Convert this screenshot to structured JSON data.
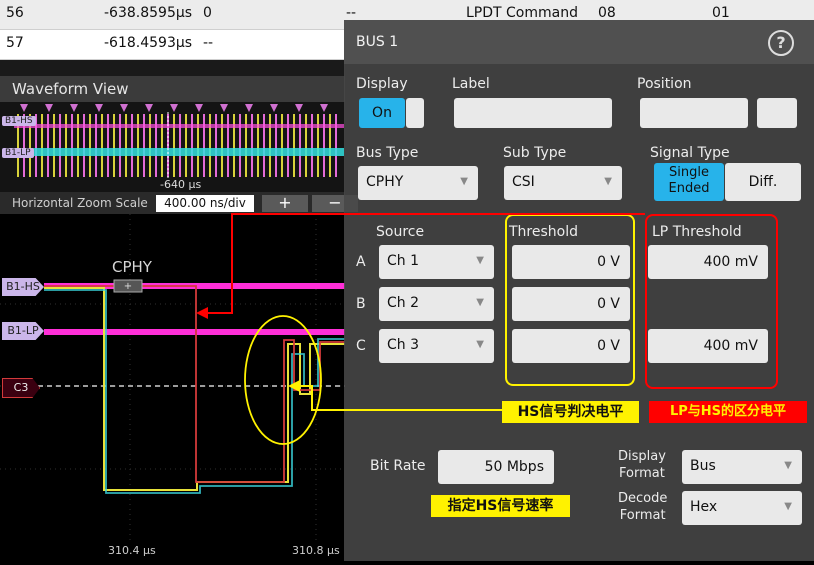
{
  "results": {
    "rows": [
      {
        "index": "56",
        "time": "-638.8595µs",
        "v1": "0",
        "v2": "--",
        "cmd": "LPDT Command",
        "c6": "08",
        "c7": "01"
      },
      {
        "index": "57",
        "time": "-618.4593µs",
        "v1": "--"
      }
    ]
  },
  "waveform_view": {
    "title": "Waveform View",
    "time_mark": "-640 µs",
    "zoom_label": "Horizontal Zoom Scale",
    "zoom_value": "400.00 ns/div",
    "zoom_in": "+",
    "zoom_out": "−",
    "bus_label": "CPHY",
    "lane_hs": "B1-HS",
    "lane_lp": "B1-LP",
    "channel": "C3",
    "time_left": "310.4 µs",
    "time_right": "310.8 µs"
  },
  "dialog": {
    "title": "BUS 1",
    "help": "?",
    "display_label": "Display",
    "display_on": "On",
    "label_label": "Label",
    "position_label": "Position",
    "bus_type_label": "Bus Type",
    "bus_type_value": "CPHY",
    "sub_type_label": "Sub Type",
    "sub_type_value": "CSI",
    "signal_type_label": "Signal Type",
    "signal_single_1": "Single",
    "signal_single_2": "Ended",
    "signal_diff": "Diff.",
    "source_label": "Source",
    "threshold_label": "Threshold",
    "lp_threshold_label": "LP Threshold",
    "rows": [
      {
        "letter": "A",
        "source": "Ch 1",
        "threshold": "0 V",
        "lp": "400 mV"
      },
      {
        "letter": "B",
        "source": "Ch 2",
        "threshold": "0 V",
        "lp": ""
      },
      {
        "letter": "C",
        "source": "Ch 3",
        "threshold": "0 V",
        "lp": "400 mV"
      }
    ],
    "bit_rate_label": "Bit Rate",
    "bit_rate_value": "50 Mbps",
    "display_format_label_1": "Display",
    "display_format_label_2": "Format",
    "display_format_value": "Bus",
    "decode_format_label_1": "Decode",
    "decode_format_label_2": "Format",
    "decode_format_value": "Hex"
  },
  "annotations": {
    "hs_threshold": "HS信号判决电平",
    "lp_hs": "LP与HS的区分电平",
    "bit_rate": "指定HS信号速率"
  },
  "colors": {
    "accent": "#27b3ea",
    "hs_lane": "#ff2fd8",
    "note_yellow": "#fff200",
    "note_red": "#ff0000"
  }
}
